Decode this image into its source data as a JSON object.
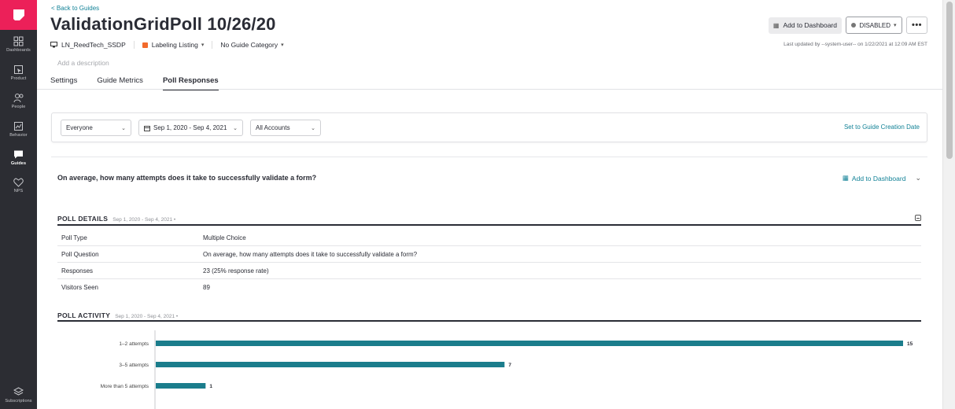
{
  "sidebar": {
    "items": [
      {
        "label": "Dashboards"
      },
      {
        "label": "Product"
      },
      {
        "label": "People"
      },
      {
        "label": "Behavior"
      },
      {
        "label": "Guides"
      },
      {
        "label": "NPS"
      }
    ],
    "bottom": {
      "label": "Subscriptions"
    }
  },
  "header": {
    "back": "< Back to Guides",
    "title": "ValidationGridPoll 10/26/20",
    "app": "LN_ReedTech_SSDP",
    "listing": "Labeling Listing",
    "category": "No Guide Category",
    "description_placeholder": "Add a description",
    "add_dashboard": "Add to Dashboard",
    "status": "DISABLED",
    "more": "•••",
    "last_updated": "Last updated by --system-user-- on 1/22/2021 at 12:09 AM EST"
  },
  "tabs": [
    {
      "label": "Settings"
    },
    {
      "label": "Guide Metrics"
    },
    {
      "label": "Poll Responses"
    }
  ],
  "filters": {
    "segment": "Everyone",
    "date_range": "Sep 1, 2020 - Sep 4, 2021",
    "accounts": "All Accounts",
    "set_date": "Set to Guide Creation Date"
  },
  "poll": {
    "question": "On average, how many attempts does it take to successfully validate a form?",
    "add_dashboard": "Add to Dashboard",
    "details_title": "POLL DETAILS",
    "details_range": "Sep 1, 2020 - Sep 4, 2021 •",
    "details": [
      {
        "k": "Poll Type",
        "v": "Multiple Choice"
      },
      {
        "k": "Poll Question",
        "v": "On average, how many attempts does it take to successfully validate a form?"
      },
      {
        "k": "Responses",
        "v": "23 (25% response rate)"
      },
      {
        "k": "Visitors Seen",
        "v": "89"
      }
    ],
    "activity_title": "POLL ACTIVITY",
    "activity_range": "Sep 1, 2020 - Sep 4, 2021 •"
  },
  "chart_data": {
    "type": "bar",
    "orientation": "horizontal",
    "categories": [
      "1–2 attempts",
      "3–5 attempts",
      "More than 5 attempts"
    ],
    "values": [
      15,
      7,
      1
    ],
    "xlim": [
      0,
      15
    ],
    "color": "#1b7d8c"
  }
}
